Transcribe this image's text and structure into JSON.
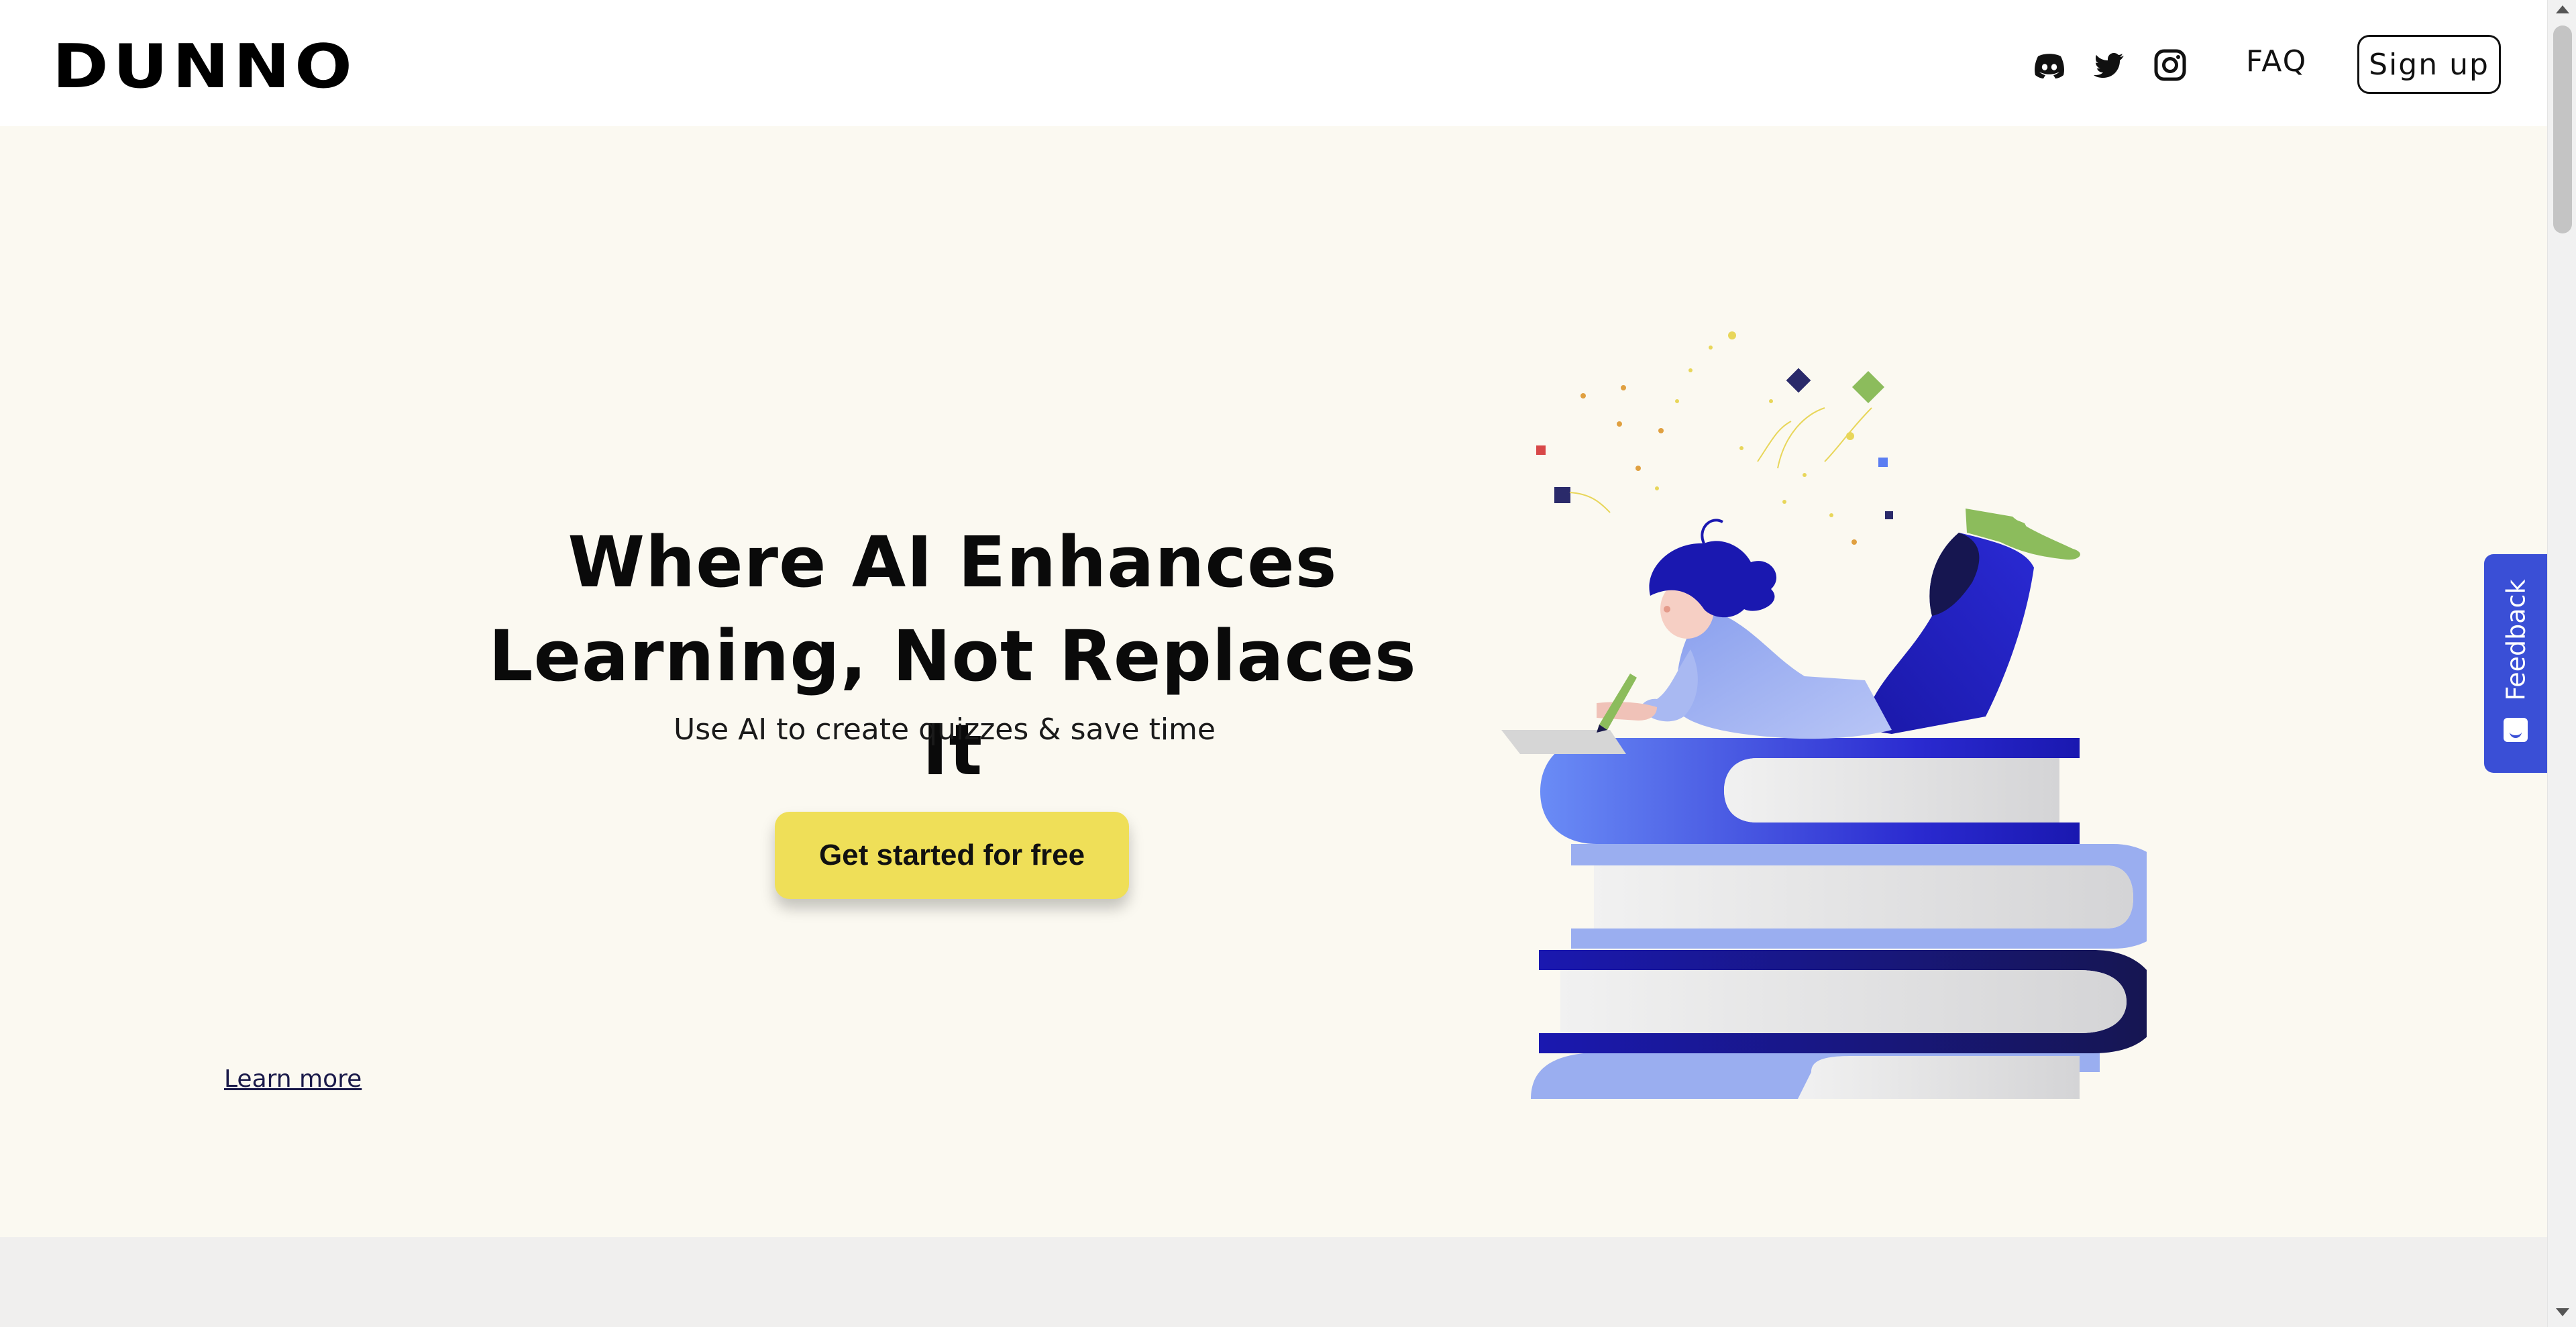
{
  "header": {
    "logo": "DUNNO",
    "social_icons": [
      "discord-icon",
      "twitter-icon",
      "instagram-icon"
    ],
    "faq_label": "FAQ",
    "signup_label": "Sign up"
  },
  "hero": {
    "title_line1": "Where AI Enhances",
    "title_line2": "Learning, Not Replaces It",
    "subtitle": "Use AI to create quizzes & save time",
    "cta_label": "Get started for free",
    "learn_more_label": "Learn more",
    "illustration": "girl-reading-on-books-illustration"
  },
  "feedback": {
    "label": "Feedback",
    "icon": "smiley-icon"
  },
  "colors": {
    "hero_bg": "#fbf9f1",
    "cta_bg": "#efdf58",
    "feedback_bg": "#3a4fd6",
    "accent_blue": "#1a18b0",
    "accent_light_blue": "#9aaef0",
    "accent_green": "#8cbc5c"
  }
}
